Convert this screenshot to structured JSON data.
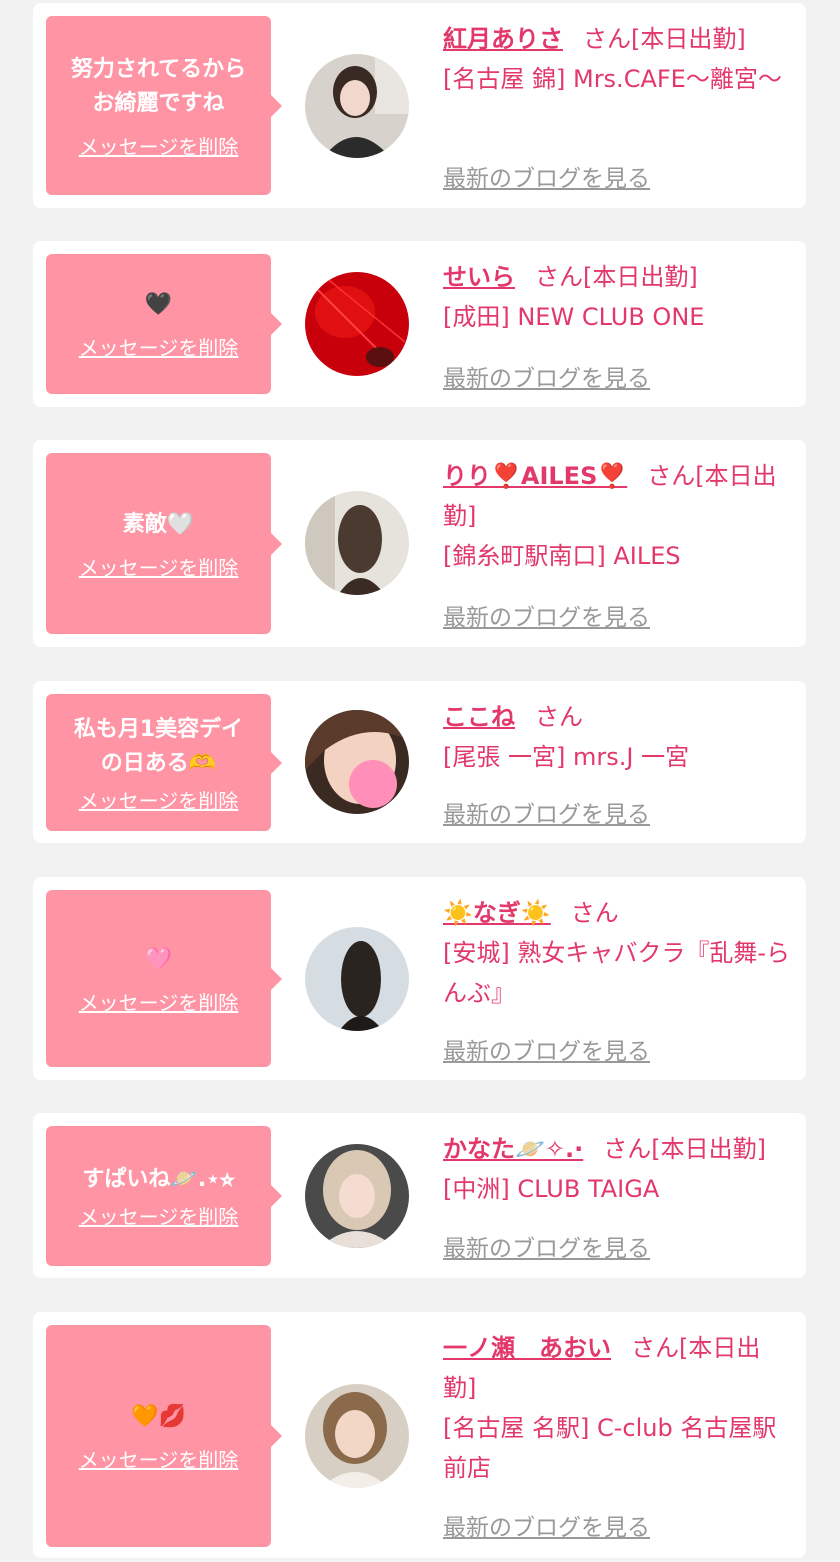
{
  "delete_label": "メッセージを削除",
  "blog_label": "最新のブログを見る",
  "colors": {
    "accent": "#e2386a",
    "bubble": "#ff94a4",
    "page_bg": "#f2f2f2",
    "link_gray": "#999999"
  },
  "cards": [
    {
      "message": "努力されてるから\nお綺麗ですね",
      "name": "紅月ありさ",
      "san": "さん[本日出勤]",
      "shop": "[名古屋 錦] Mrs.CAFE〜離宮〜",
      "avatar_icon": "woman-portrait-icon"
    },
    {
      "message": "🖤",
      "name": "せいら",
      "san": "さん[本日出勤]",
      "shop": "[成田] NEW CLUB ONE",
      "avatar_icon": "red-photo-icon"
    },
    {
      "message": "素敵🤍",
      "name": "りり❣️AILES❣️",
      "san": "さん[本日出勤]",
      "shop": "[錦糸町駅南口] AILES",
      "avatar_icon": "long-hair-back-icon"
    },
    {
      "message": "私も月1美容デイ\nの日ある🫶",
      "name": "ここね",
      "san": "さん",
      "shop": "[尾張 一宮] mrs.J 一宮",
      "avatar_icon": "blurred-face-icon"
    },
    {
      "message": "🩷",
      "name": "☀️なぎ☀️",
      "san": "さん",
      "shop": "[安城] 熟女キャバクラ『乱舞-らんぶ』",
      "avatar_icon": "dark-hair-back-icon"
    },
    {
      "message": "すぱいね🪐.⋆⭐︎",
      "name": "かなた🪐✧.·",
      "san": "さん[本日出勤]",
      "shop": "[中洲] CLUB TAIGA",
      "avatar_icon": "blonde-woman-icon"
    },
    {
      "message": "🧡💋",
      "name": "一ノ瀬　あおい",
      "san": "さん[本日出勤]",
      "shop": "[名古屋 名駅] C-club 名古屋駅前店",
      "avatar_icon": "smiling-woman-icon"
    }
  ]
}
